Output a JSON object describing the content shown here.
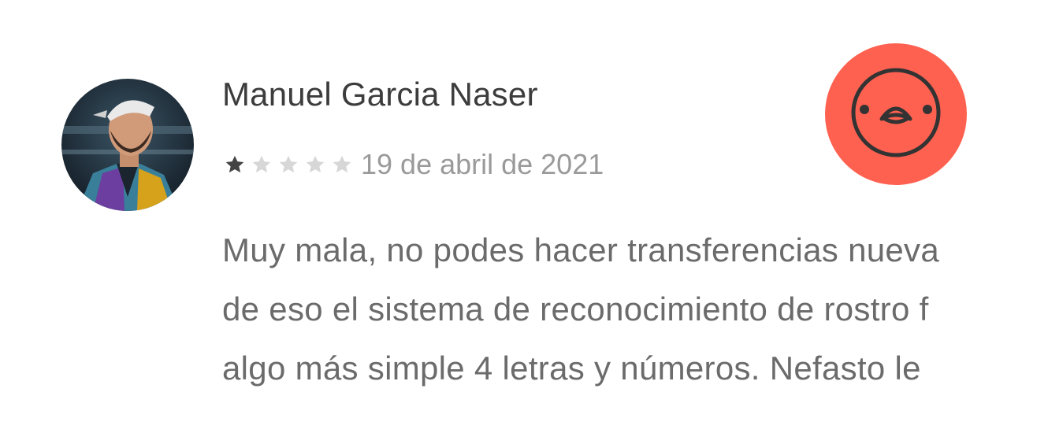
{
  "review": {
    "reviewer_name": "Manuel Garcia Naser",
    "rating": 1,
    "rating_max": 5,
    "star_colors": {
      "filled": "#444444",
      "empty": "#d7d7d7"
    },
    "date": "19 de abril de 2021",
    "text_lines": [
      "Muy mala, no podes hacer transferencias nueva",
      "de eso el sistema de reconocimiento de rostro f",
      "algo más simple 4 letras y números. Nefasto le"
    ]
  },
  "sentiment": {
    "icon": "angry-face-icon",
    "color": "#ff6150"
  }
}
